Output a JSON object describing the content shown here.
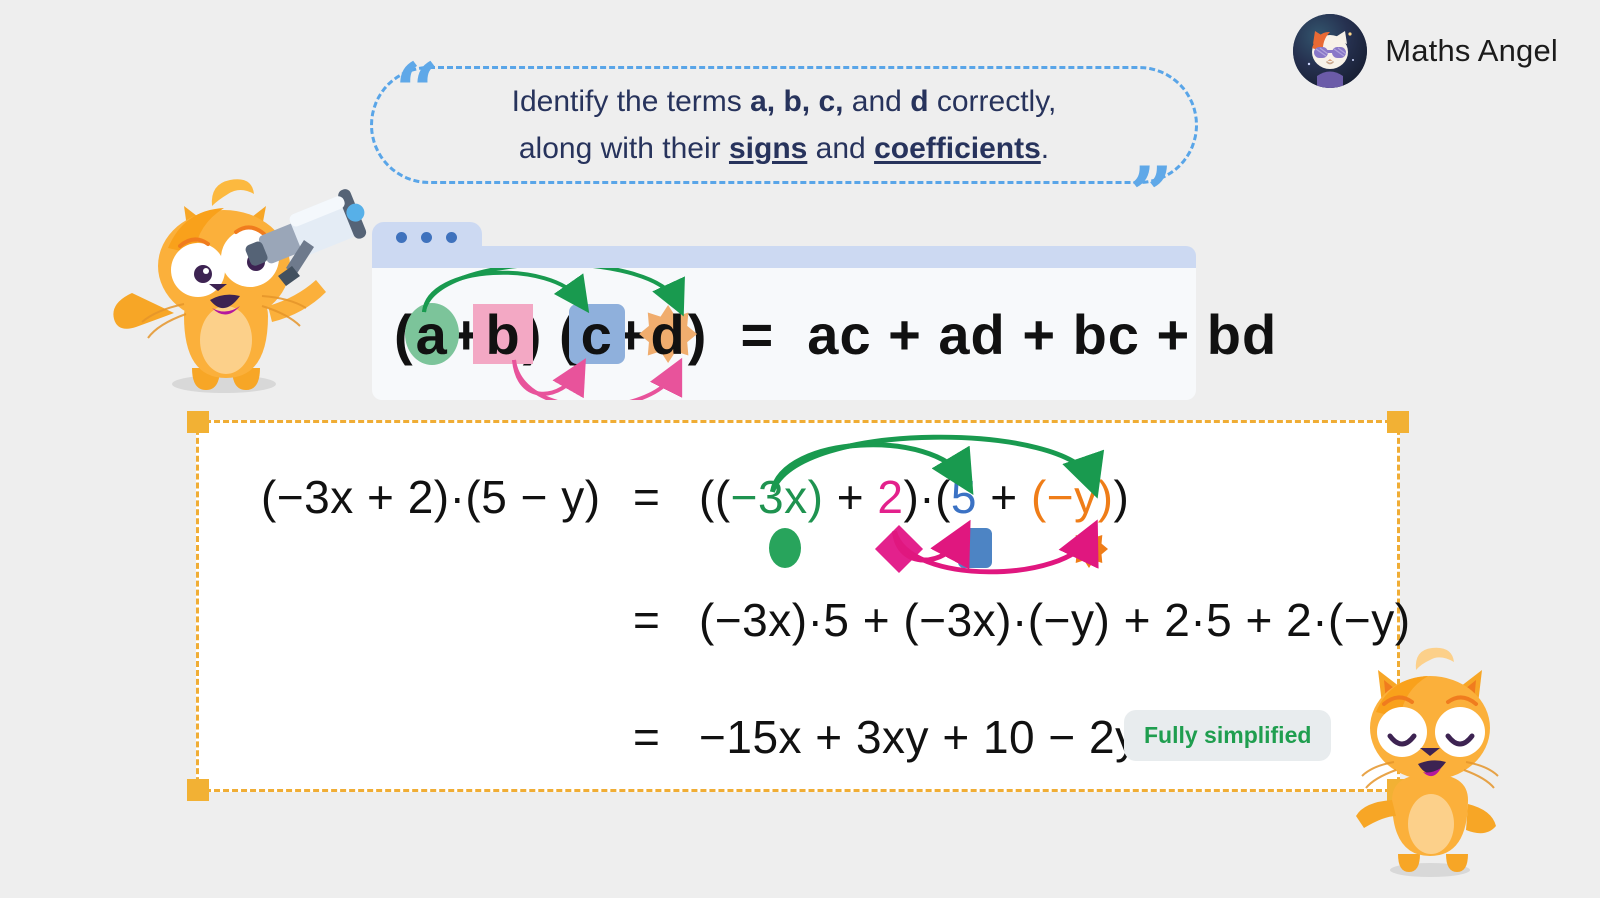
{
  "brand": {
    "name": "Maths Angel",
    "logo_icon": "cat-avatar-logo"
  },
  "callout": {
    "text_line1_pre": "Identify the terms ",
    "text_line1_bold": "a, b, c,",
    "text_line1_mid": " and ",
    "text_line1_bold2": "d",
    "text_line1_post": " correctly,",
    "text_line2_pre": "along with their ",
    "text_line2_u1": "signs",
    "text_line2_mid": " and ",
    "text_line2_u2": "coefficients",
    "text_line2_post": ".",
    "quote_open": "“",
    "quote_close": "”"
  },
  "formula_card": {
    "window_dots": 3,
    "expr": {
      "open1": "(",
      "a": "a",
      "plus1": "+",
      "b": "b",
      "close1": ")",
      "open2": "(",
      "c": "c",
      "plus2": "+",
      "d": "d",
      "close2": ")",
      "equals": "=",
      "result": "ac + ad + bc + bd"
    },
    "markers": {
      "a_shape": "circle",
      "b_shape": "diamond",
      "c_shape": "square",
      "d_shape": "starburst"
    }
  },
  "worked_example": {
    "line1": {
      "left": "(−3x + 2)·(5 − y)",
      "equals": "=",
      "r_open1": "((",
      "r_term_a": "−3x",
      "r_close_a": ")",
      "r_plus1": " + ",
      "r_term_b": "2",
      "r_close_b": ")·(",
      "r_term_c": "5",
      "r_plus2": " + ",
      "r_term_d": "(−y)",
      "r_close2": ")"
    },
    "line2": {
      "equals": "=",
      "body": "(−3x)·5 + (−3x)·(−y) + 2·5 + 2·(−y)"
    },
    "line3": {
      "equals": "=",
      "body": "−15x + 3xy + 10 − 2y",
      "badge": "Fully simplified"
    },
    "legend_shapes": [
      "circle",
      "diamond",
      "square",
      "starburst"
    ]
  },
  "mascots": {
    "left": "cat-with-telescope",
    "right": "happy-cat"
  },
  "colors": {
    "background": "#eeeeee",
    "green": "#1f9350",
    "pink": "#e3218c",
    "blue": "#3b72c4",
    "orange": "#ef7d18",
    "amber_frame": "#f0ad35",
    "bubble_border": "#59a5e8",
    "text_dark": "#27335c",
    "badge_green": "#1f9e4f"
  }
}
